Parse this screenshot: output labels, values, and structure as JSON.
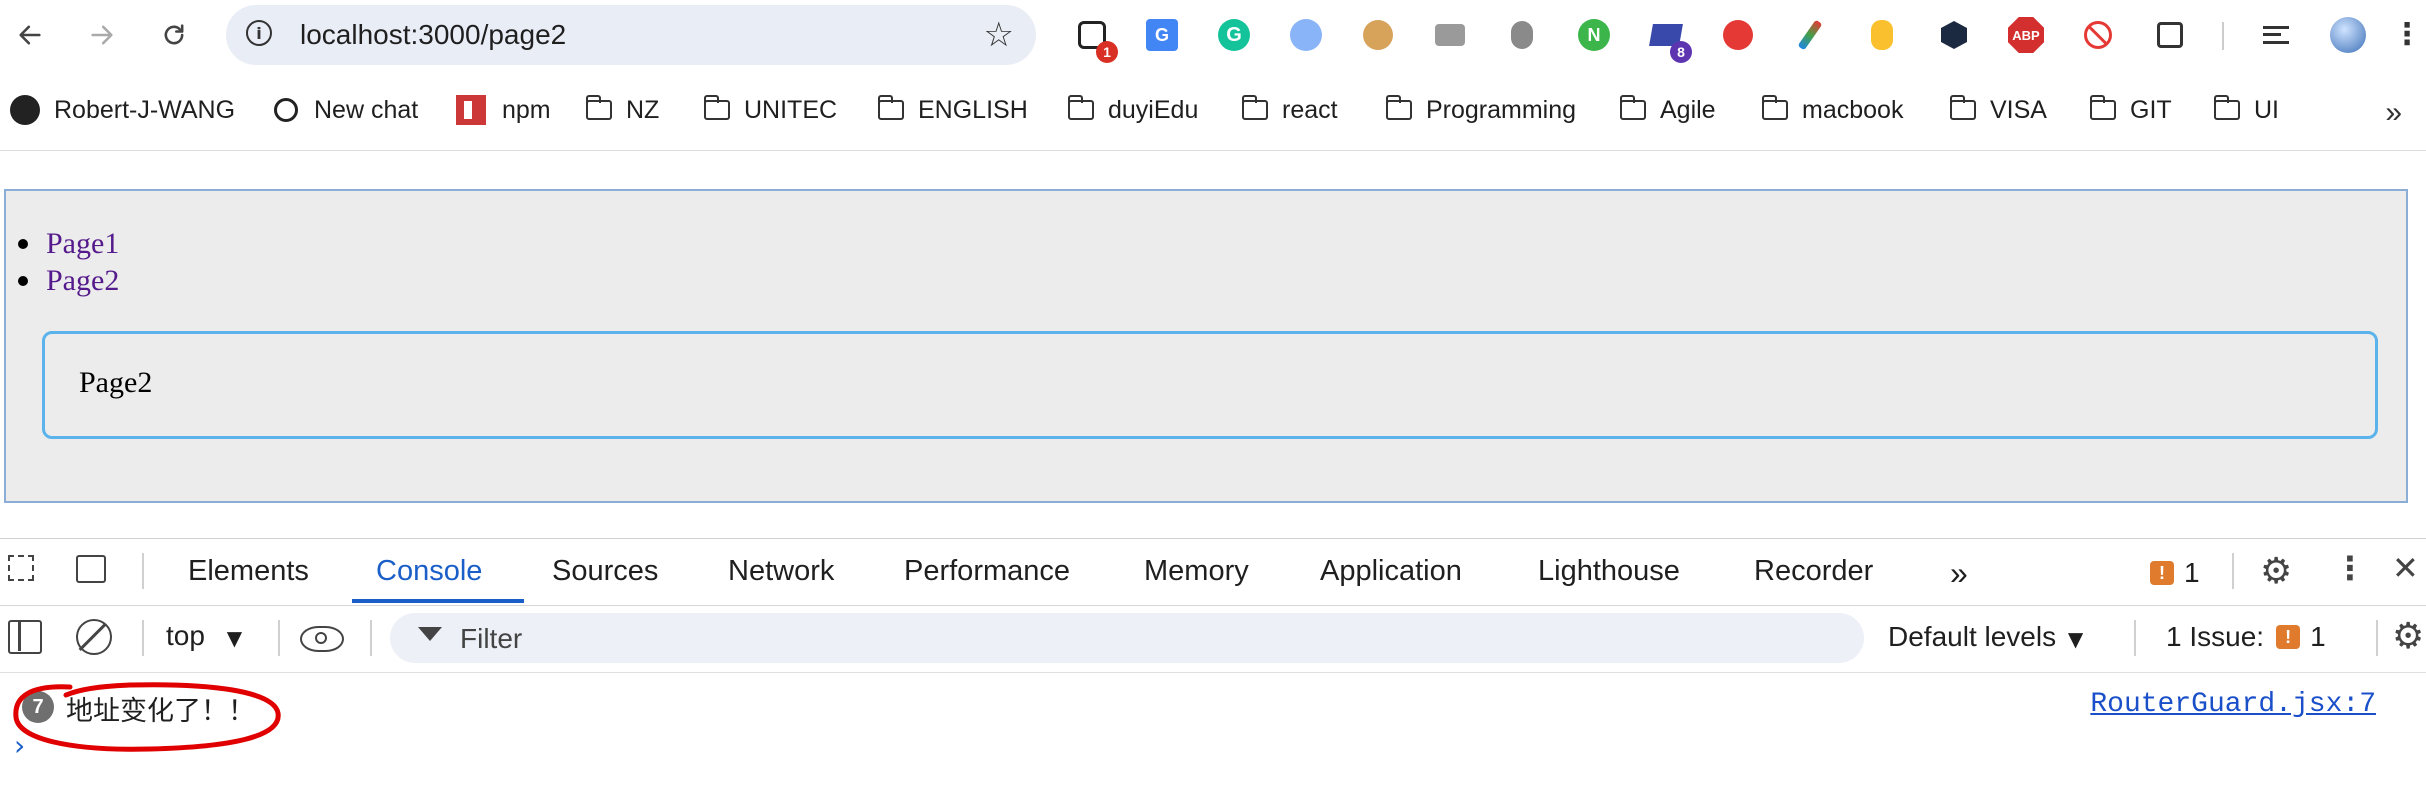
{
  "address_bar": {
    "url": "localhost:3000/page2",
    "back_icon": "arrow-left-icon",
    "forward_icon": "arrow-right-icon",
    "reload_icon": "reload-icon",
    "bookmark_star_icon": "star-icon"
  },
  "extensions": [
    {
      "icon": "toolbox-extension-icon",
      "badge": "1",
      "badge_color": "#d93025"
    },
    {
      "icon": "google-translate-icon",
      "badge": ""
    },
    {
      "icon": "grammarly-icon",
      "badge": ""
    },
    {
      "icon": "search-lens-icon",
      "badge": ""
    },
    {
      "icon": "cookie-icon",
      "badge": ""
    },
    {
      "icon": "camera-icon",
      "badge": ""
    },
    {
      "icon": "bug-icon",
      "badge": ""
    },
    {
      "icon": "node-icon",
      "badge": ""
    },
    {
      "icon": "graduation-cap-icon",
      "badge": "8",
      "badge_color": "#5e35b1"
    },
    {
      "icon": "sync-icon",
      "badge": ""
    },
    {
      "icon": "color-picker-icon",
      "badge": ""
    },
    {
      "icon": "mouse-icon",
      "badge": ""
    },
    {
      "icon": "dark-hex-icon",
      "badge": ""
    },
    {
      "icon": "adblock-plus-icon",
      "label": "ABP"
    },
    {
      "icon": "block-icon",
      "badge": ""
    },
    {
      "icon": "puzzle-icon",
      "badge": ""
    },
    {
      "icon": "media-queue-icon",
      "badge": ""
    },
    {
      "icon": "profile-avatar-icon",
      "badge": ""
    },
    {
      "icon": "more-vertical-icon",
      "badge": ""
    }
  ],
  "bookmarks": [
    {
      "label": "Robert-J-WANG",
      "icon": "github-icon"
    },
    {
      "label": "New chat",
      "icon": "openai-icon"
    },
    {
      "label": "npm",
      "icon": "npm-icon"
    },
    {
      "label": "NZ",
      "icon": "folder-icon"
    },
    {
      "label": "UNITEC",
      "icon": "folder-icon"
    },
    {
      "label": "ENGLISH",
      "icon": "folder-icon"
    },
    {
      "label": "duyiEdu",
      "icon": "folder-icon"
    },
    {
      "label": "react",
      "icon": "folder-icon"
    },
    {
      "label": "Programming",
      "icon": "folder-icon"
    },
    {
      "label": "Agile",
      "icon": "folder-icon"
    },
    {
      "label": "macbook",
      "icon": "folder-icon"
    },
    {
      "label": "VISA",
      "icon": "folder-icon"
    },
    {
      "label": "GIT",
      "icon": "folder-icon"
    },
    {
      "label": "UI",
      "icon": "folder-icon"
    }
  ],
  "bookmarks_overflow": "»",
  "page": {
    "links": [
      "Page1",
      "Page2"
    ],
    "content": "Page2"
  },
  "devtools": {
    "tabs": [
      "Elements",
      "Console",
      "Sources",
      "Network",
      "Performance",
      "Memory",
      "Application",
      "Lighthouse",
      "Recorder"
    ],
    "active_tab": "Console",
    "more_tabs": "»",
    "issues_count": "1",
    "context": "top",
    "filter_placeholder": "Filter",
    "levels": "Default levels",
    "issues_label": "1 Issue:",
    "issues_label_count": "1",
    "console_messages": [
      {
        "count": "7",
        "text": "地址变化了！！",
        "source": "RouterGuard.jsx:7"
      }
    ],
    "prompt_symbol": "›",
    "annotation_color": "#e00000"
  }
}
